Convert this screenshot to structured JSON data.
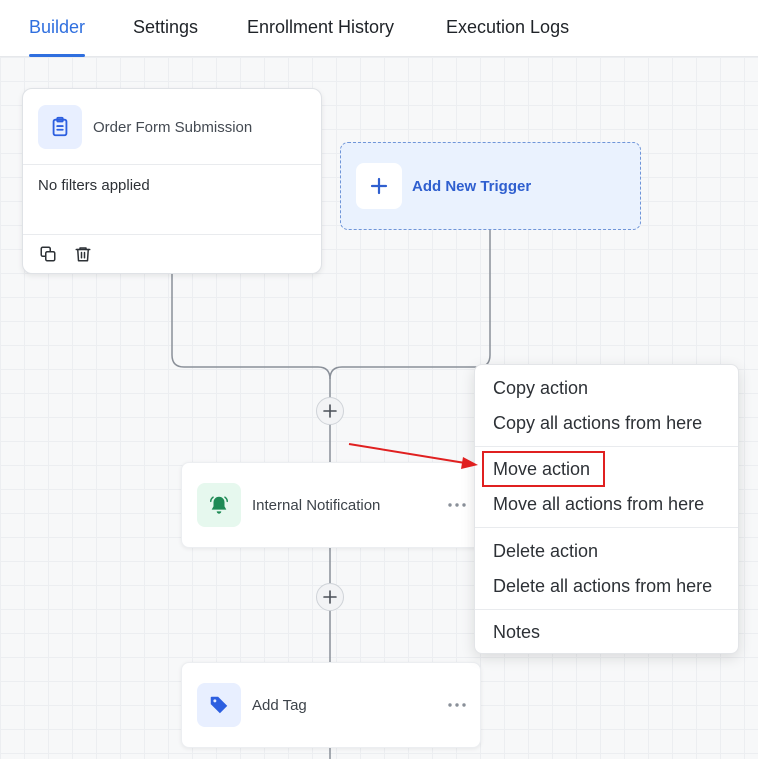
{
  "tabs": [
    {
      "label": "Builder",
      "active": true
    },
    {
      "label": "Settings",
      "active": false
    },
    {
      "label": "Enrollment History",
      "active": false
    },
    {
      "label": "Execution Logs",
      "active": false
    }
  ],
  "trigger": {
    "title": "Order Form Submission",
    "filter_text": "No filters applied",
    "icon": "clipboard-icon",
    "footer_icons": [
      "copy-icon",
      "trash-icon"
    ]
  },
  "add_trigger": {
    "label": "Add New Trigger",
    "icon": "plus-icon"
  },
  "actions": [
    {
      "label": "Internal Notification",
      "icon": "bell-icon",
      "icon_color": "#1e8a55",
      "icon_bg": "#e6f8ee"
    },
    {
      "label": "Add Tag",
      "icon": "tag-icon",
      "icon_color": "#2d5fe0",
      "icon_bg": "#e8efff"
    }
  ],
  "context_menu": {
    "items": [
      {
        "label": "Copy action"
      },
      {
        "label": "Copy all actions from here"
      },
      {
        "label": "Move action",
        "highlighted": true
      },
      {
        "label": "Move all actions from here"
      },
      {
        "label": "Delete action"
      },
      {
        "label": "Delete all actions from here"
      },
      {
        "label": "Notes"
      }
    ]
  },
  "colors": {
    "accent": "#2f6fdf",
    "highlight": "#e02020"
  }
}
